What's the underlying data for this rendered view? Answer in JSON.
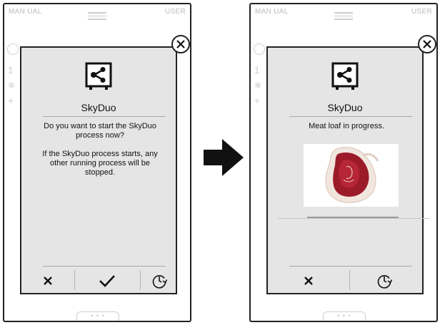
{
  "screens": [
    {
      "topbar": {
        "left": "MAN UAL",
        "right": "USER"
      },
      "dialog": {
        "title": "SkyDuo",
        "question": "Do you want to start the SkyDuo process now?",
        "warning": "If the SkyDuo process starts, any other running process will be stopped.",
        "actions": [
          "cancel-icon",
          "confirm-check-icon",
          "timer-icon"
        ]
      }
    },
    {
      "topbar": {
        "left": "MAN UAL",
        "right": "USER"
      },
      "dialog": {
        "title": "SkyDuo",
        "status": "Meat loaf in progress.",
        "image": "raw-meat-cut",
        "actions": [
          "cancel-icon",
          "timer-icon"
        ]
      }
    }
  ],
  "bottom_tab_label": "• • •",
  "ghost_background_glyphs": [
    "1",
    "❄",
    "+"
  ],
  "flow_arrow": "right-arrow",
  "colors": {
    "dialog_bg": "#e5e5e5",
    "border": "#222222",
    "ghost": "#d0d0d0"
  }
}
